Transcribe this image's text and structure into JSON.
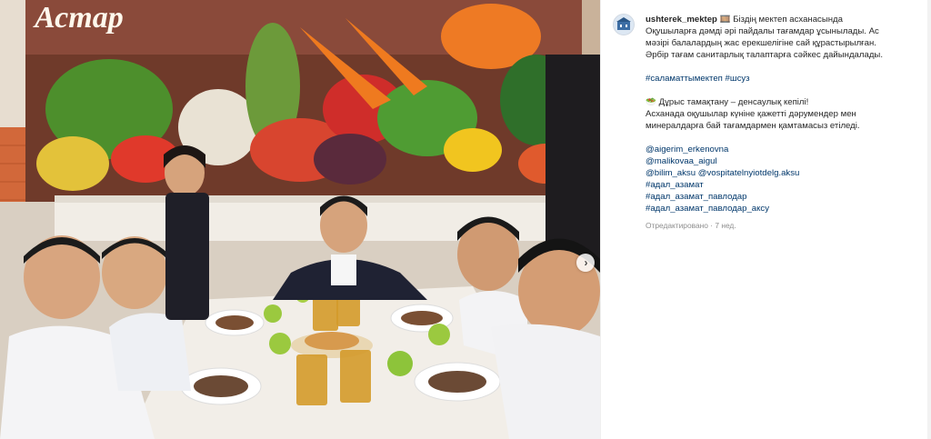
{
  "post": {
    "username": "ushterek_mektep",
    "intro_emoji": "🎞️",
    "caption_lines": [
      "Біздің мектеп асханасында",
      "Оқушыларға дәмді әрі пайдалы тағамдар ұсынылады. Ас",
      "мәзірі балалардың жас ерекшелігіне сай құрастырылған.",
      "Әрбір тағам санитарлық талаптарға сәйкес дайындалады."
    ],
    "hashtags_line": [
      "#саламаттымектеп",
      "#шсуз"
    ],
    "health_line_emoji": "🥗",
    "health_title": "Дұрыс тамақтану – денсаулық кепілі!",
    "health_lines": [
      "Асханада оқушылар күніне қажетті дәрумендер мен",
      "минералдарға бай тағамдармен қамтамасыз етіледі."
    ],
    "mentions": [
      "@aigerim_erkenovna",
      "@malikovaa_aigul",
      "@bilim_aksu",
      "@vospitatelnyiotdelg.aksu"
    ],
    "tags": [
      "#адал_азамат",
      "#адал_азамат_павлодар",
      "#адал_азамат_павлодар_аксу"
    ],
    "edited_text": "Отредактировано · 7 нед."
  },
  "photo": {
    "banner_text": "Астар",
    "next_icon": "chevron-right-icon",
    "next_glyph": "›"
  },
  "colors": {
    "link": "#00376b",
    "muted": "#8e8e8e",
    "text": "#262626"
  }
}
